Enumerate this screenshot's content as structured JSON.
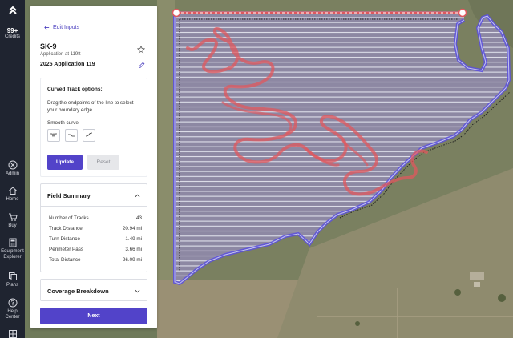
{
  "rail": {
    "credits_count": "99+",
    "credits_label": "Credits",
    "items": [
      {
        "label": "Admin"
      },
      {
        "label": "Home"
      },
      {
        "label": "Buy"
      },
      {
        "label_line1": "Equipment",
        "label_line2": "Explorer"
      },
      {
        "label": "Plans"
      },
      {
        "label_line1": "Help",
        "label_line2": "Center"
      }
    ]
  },
  "panel": {
    "back_label": "Edit Inputs",
    "field_name": "SK-9",
    "field_sub": "Application at 119ft",
    "application_name": "2025 Application 119",
    "curved": {
      "title": "Curved Track options:",
      "description": "Drag the endpoints of the line to select your boundary edge.",
      "smooth_label": "Smooth curve",
      "update_label": "Update",
      "reset_label": "Reset"
    },
    "summary": {
      "title": "Field Summary",
      "rows": [
        {
          "label": "Number of Tracks",
          "value": "43"
        },
        {
          "label": "Track Distance",
          "value": "20.94 mi"
        },
        {
          "label": "Turn Distance",
          "value": "1.49 mi"
        },
        {
          "label": "Perimeter Pass",
          "value": "3.66 mi"
        },
        {
          "label": "Total Distance",
          "value": "26.09 mi"
        }
      ]
    },
    "coverage_title": "Coverage Breakdown",
    "next_label": "Next"
  },
  "colors": {
    "accent": "#5243c9",
    "rail_bg": "#1f2430",
    "track_red": "#e0585e",
    "boundary_blue": "#5b4fe0",
    "field_overlay": "#8f8aa8"
  }
}
